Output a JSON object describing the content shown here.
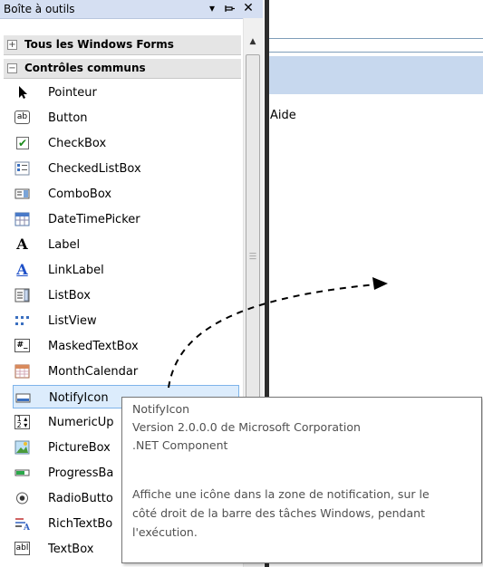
{
  "toolbox": {
    "title": "Boîte à outils",
    "groups": [
      {
        "label": "Tous les Windows Forms",
        "expander": "+"
      },
      {
        "label": "Contrôles communs",
        "expander": "−"
      }
    ],
    "items": [
      {
        "label": "Pointeur",
        "icon": "pointer-icon"
      },
      {
        "label": "Button",
        "icon": "button-icon"
      },
      {
        "label": "CheckBox",
        "icon": "checkbox-icon"
      },
      {
        "label": "CheckedListBox",
        "icon": "checkedlistbox-icon"
      },
      {
        "label": "ComboBox",
        "icon": "combobox-icon"
      },
      {
        "label": "DateTimePicker",
        "icon": "datetimepicker-icon"
      },
      {
        "label": "Label",
        "icon": "label-icon"
      },
      {
        "label": "LinkLabel",
        "icon": "linklabel-icon"
      },
      {
        "label": "ListBox",
        "icon": "listbox-icon"
      },
      {
        "label": "ListView",
        "icon": "listview-icon"
      },
      {
        "label": "MaskedTextBox",
        "icon": "maskedtextbox-icon"
      },
      {
        "label": "MonthCalendar",
        "icon": "monthcalendar-icon"
      },
      {
        "label": "NotifyIcon",
        "icon": "notifyicon-icon"
      },
      {
        "label": "NumericUp",
        "icon": "numericupdown-icon"
      },
      {
        "label": "PictureBox",
        "icon": "picturebox-icon"
      },
      {
        "label": "ProgressBa",
        "icon": "progressbar-icon"
      },
      {
        "label": "RadioButto",
        "icon": "radiobutton-icon"
      },
      {
        "label": "RichTextBo",
        "icon": "richtextbox-icon"
      },
      {
        "label": "TextBox",
        "icon": "textbox-icon"
      }
    ],
    "selected_item": "NotifyIcon"
  },
  "designer": {
    "menu_label": "Aide"
  },
  "tooltip": {
    "name": "NotifyIcon",
    "version": "Version 2.0.0.0 de Microsoft Corporation",
    "component": ".NET Component",
    "description_line1": "Affiche une icône dans la zone de notification, sur le",
    "description_line2": "côté droit de la barre des tâches Windows, pendant",
    "description_line3": "l'exécution."
  },
  "colors": {
    "title_bg": "#d5dff2",
    "selection_bg": "#dcecfc",
    "selection_border": "#7eb4ea",
    "splitter": "#2c2c2c"
  }
}
